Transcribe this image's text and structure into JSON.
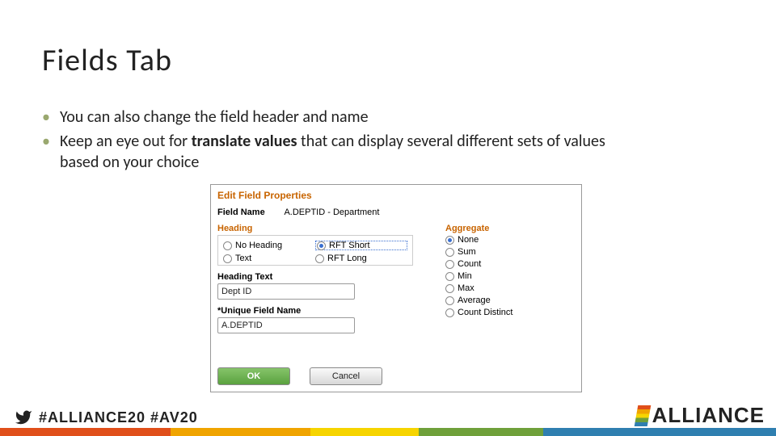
{
  "title": "Fields Tab",
  "bullets": {
    "b1": "You can also change the field header and name",
    "b2a": "Keep an eye out for ",
    "b2b": "translate values",
    "b2c": " that can display several different sets of values based on your choice"
  },
  "dialog": {
    "title": "Edit Field Properties",
    "fieldname_label": "Field Name",
    "fieldname_value": "A.DEPTID - Department",
    "heading_section": "Heading",
    "aggregate_section": "Aggregate",
    "heading_options": {
      "no_heading": "No Heading",
      "rft_short": "RFT Short",
      "text": "Text",
      "rft_long": "RFT Long",
      "selected": "rft_short"
    },
    "heading_text_label": "Heading Text",
    "heading_text_value": "Dept ID",
    "unique_label": "*Unique Field Name",
    "unique_value": "A.DEPTID",
    "aggregate_options": [
      "None",
      "Sum",
      "Count",
      "Min",
      "Max",
      "Average",
      "Count Distinct"
    ],
    "aggregate_selected": "None",
    "ok_label": "OK",
    "cancel_label": "Cancel"
  },
  "footer": {
    "hashtag1": "#ALLIANCE20",
    "hashtag2": "#AV20",
    "brand": "ALLIANCE"
  }
}
